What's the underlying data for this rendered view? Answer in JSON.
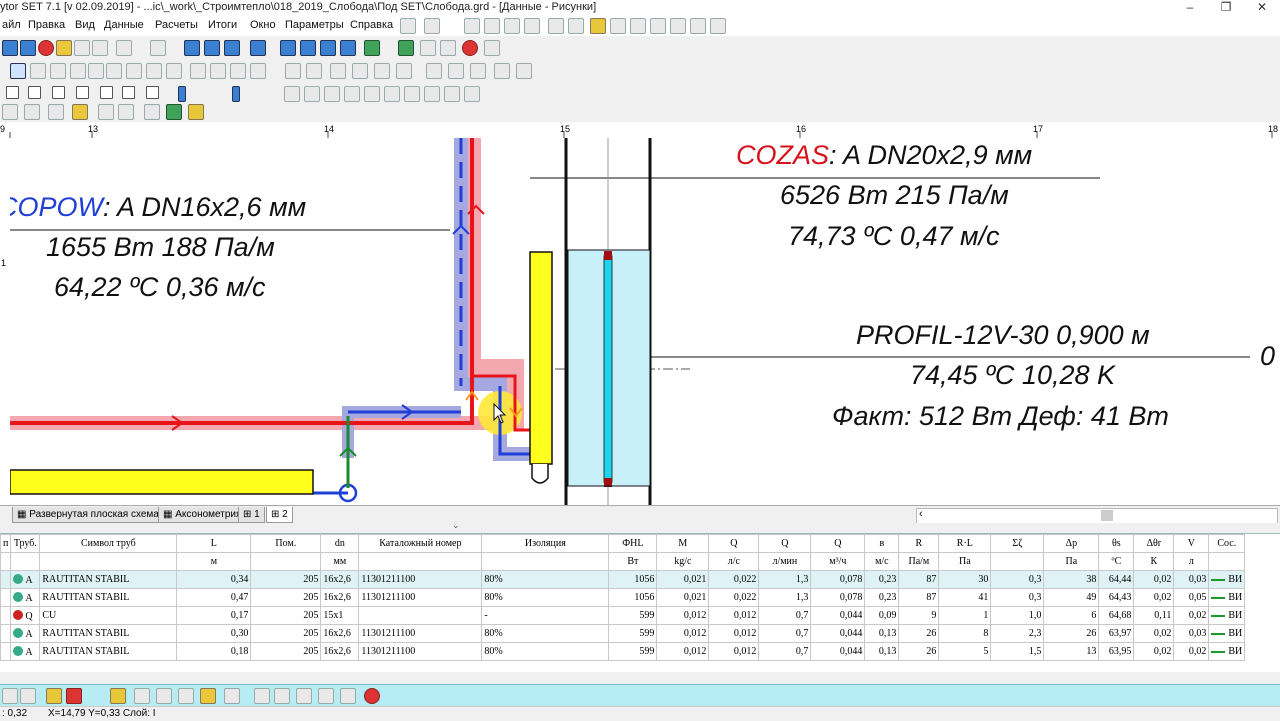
{
  "window": {
    "title": "ytor SET 7.1  [v 02.09.2019] - ...ic\\_work\\_Строимтепло\\018_2019_Слобода\\Под SET\\Слобода.grd - [Данные - Рисунки]",
    "minimize": "–",
    "maximize": "❐",
    "close": "✕"
  },
  "menu": [
    "айл",
    "Правка",
    "Вид",
    "Данные",
    "Расчеты",
    "Итоги",
    "Окно",
    "Параметры",
    "Справка"
  ],
  "ruler": {
    "marks": [
      "9",
      "13",
      "14",
      "15",
      "16",
      "17",
      "18"
    ]
  },
  "vruler": {
    "marks": [
      "1"
    ]
  },
  "drawing": {
    "pipe_left": {
      "code": "COPOW",
      "spec": ": A DN16x2,6 мм",
      "line2": "1655 Вт 188 Па/м",
      "line3": "64,22 ºC 0,36 м/с"
    },
    "pipe_right": {
      "code": "COZAS",
      "spec": ": A DN20x2,9 мм",
      "line2": "6526 Вт 215 Па/м",
      "line3": "74,73 ºC 0,47 м/с"
    },
    "radiator": {
      "line1": "PROFIL-12V-30  0,900 м",
      "line2": "74,45 ºC 10,28 K",
      "line3": "Факт: 512 Вт  Деф: 41 Вт",
      "edge": "0"
    },
    "colors": {
      "supply": "#e8141c",
      "return": "#1f3fd6",
      "label_blue": "#1f3fd6",
      "label_red": "#d8121c",
      "radiator_fill": "#ffff1e",
      "panel_fill": "#c8f0f8",
      "highlight": "#ffe83a"
    }
  },
  "tabs": [
    "Развернутая плоская схема",
    "Аксонометрия",
    "1",
    "2"
  ],
  "grid": {
    "headers": [
      "п",
      "Труб.",
      "Символ труб",
      "L",
      "Пом.",
      "dn",
      "Каталожный номер",
      "Изоляция",
      "ФHL",
      "M",
      "Q",
      "Q",
      "Q",
      "в",
      "R",
      "R·L",
      "Σζ",
      "Δp",
      "θs",
      "Δθr",
      "V",
      "Сос."
    ],
    "units": [
      "",
      "",
      "",
      "м",
      "",
      "мм",
      "",
      "",
      "Вт",
      "kg/c",
      "л/с",
      "л/мин",
      "м³/ч",
      "м/с",
      "Па/м",
      "Па",
      "",
      "Па",
      "ºC",
      "К",
      "л",
      ""
    ],
    "rows": [
      [
        "",
        "A",
        "RAUTITAN STABIL",
        "0,34",
        "205",
        "16x2,6",
        "11301211100",
        "80%",
        "1056",
        "0,021",
        "0,022",
        "1,3",
        "0,078",
        "0,23",
        "87",
        "30",
        "0,3",
        "38",
        "64,44",
        "0,02",
        "0,03",
        "ВИ"
      ],
      [
        "",
        "A",
        "RAUTITAN STABIL",
        "0,47",
        "205",
        "16x2,6",
        "11301211100",
        "80%",
        "1056",
        "0,021",
        "0,022",
        "1,3",
        "0,078",
        "0,23",
        "87",
        "41",
        "0,3",
        "49",
        "64,43",
        "0,02",
        "0,05",
        "ВИ"
      ],
      [
        "",
        "Q",
        "CU",
        "0,17",
        "205",
        "15x1",
        "",
        "-",
        "599",
        "0,012",
        "0,012",
        "0,7",
        "0,044",
        "0,09",
        "9",
        "1",
        "1,0",
        "6",
        "64,68",
        "0,11",
        "0,02",
        "ВИ"
      ],
      [
        "",
        "A",
        "RAUTITAN STABIL",
        "0,30",
        "205",
        "16x2,6",
        "11301211100",
        "80%",
        "599",
        "0,012",
        "0,012",
        "0,7",
        "0,044",
        "0,13",
        "26",
        "8",
        "2,3",
        "26",
        "63,97",
        "0,02",
        "0,03",
        "ВИ"
      ],
      [
        "",
        "A",
        "RAUTITAN STABIL",
        "0,18",
        "205",
        "16x2,6",
        "11301211100",
        "80%",
        "599",
        "0,012",
        "0,012",
        "0,7",
        "0,044",
        "0,13",
        "26",
        "5",
        "1,5",
        "13",
        "63,95",
        "0,02",
        "0,02",
        "ВИ"
      ]
    ],
    "selected_row": 0
  },
  "status": {
    "left": ": 0,32",
    "coords": "X=14,79  Y=0,33  Слой: I"
  }
}
